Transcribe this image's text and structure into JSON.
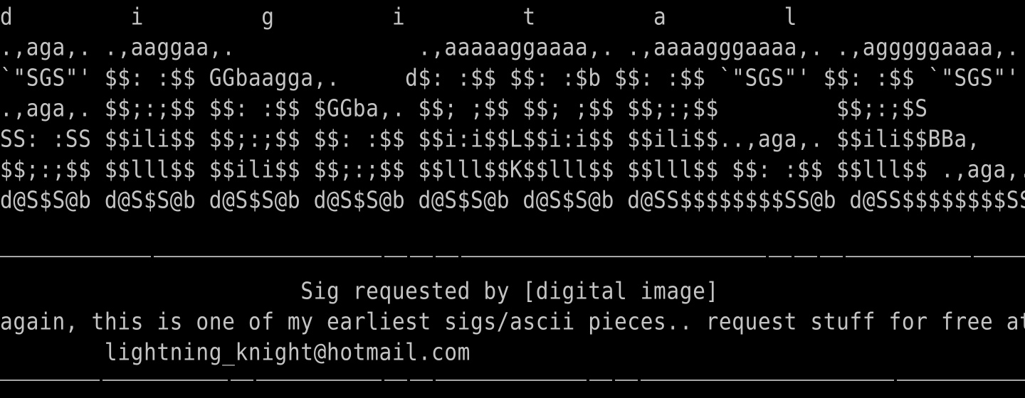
{
  "art": {
    "lines": [
      "d         i         g         i         t         a         l",
      ".,aga,. .,aaggaa,.              .,aaaaaggaaaa,. .,aaaagggaaaa,. .,agggggaaaa,.",
      "`\"SGS\"' $$: :$$ GGbaagga,.     d$: :$$ $$: :$b $$: :$$ `\"SGS\"' $$: :$$ `\"SGS\"'",
      ".,aga,. $$;:;$$ $$: :$$ $GGba,. $$; ;$$ $$; ;$$ $$;:;$$         $$;:;$S",
      "SS: :SS $$ili$$ $$;:;$$ $$: :$$ $$i:i$$L$$i:i$$ $$ili$$..,aga,. $$ili$$BBa,",
      "$$;:;$$ $$lll$$ $$ili$$ $$;:;$$ $$lll$$K$$lll$$ $$lll$$ $$: :$$ $$lll$$ .,aga,.",
      "d@S$S@b d@S$S@b d@S$S@b d@S$S@b d@S$S@b d@S$S@b d@SS$$$$$$$$SS@b d@SS$$$$$$$$SS@b"
    ]
  },
  "footer": {
    "title": "                       Sig requested by [digital image]",
    "message": "again, this is one of my earliest sigs/ascii pieces.. request stuff for free at",
    "email": "        lightning_knight@hotmail.com"
  }
}
